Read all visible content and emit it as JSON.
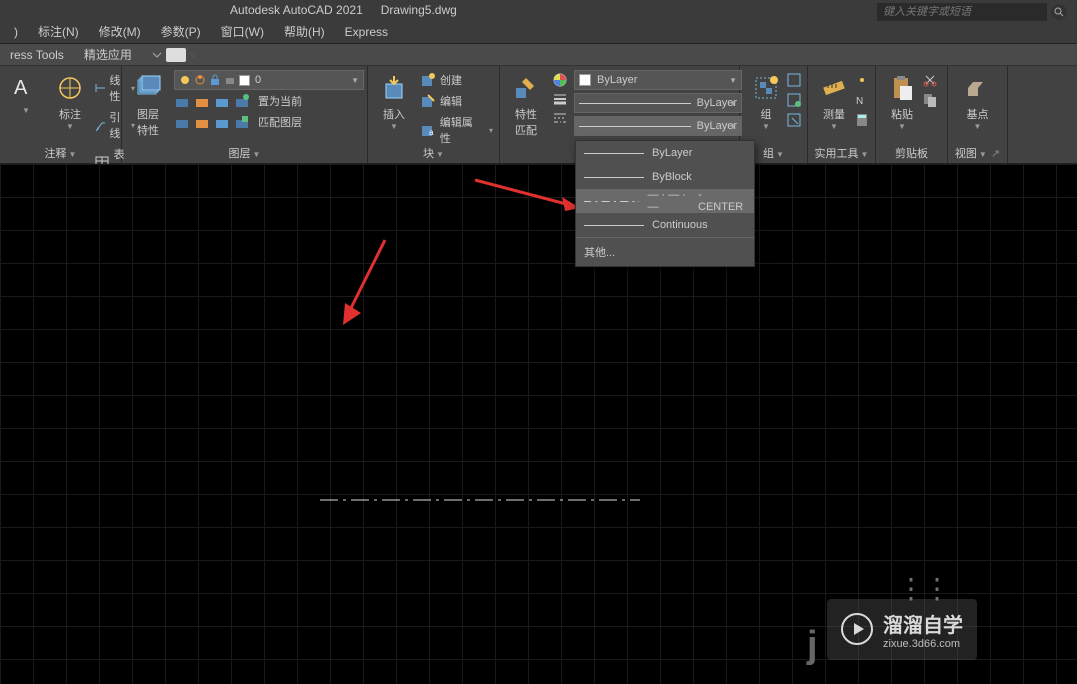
{
  "titlebar": {
    "app": "Autodesk AutoCAD 2021",
    "doc": "Drawing5.dwg"
  },
  "search": {
    "placeholder": "键入关键字或短语"
  },
  "menubar": [
    {
      "label": ")"
    },
    {
      "label": "标注(N)"
    },
    {
      "label": "修改(M)"
    },
    {
      "label": "参数(P)"
    },
    {
      "label": "窗口(W)"
    },
    {
      "label": "帮助(H)"
    },
    {
      "label": "Express"
    }
  ],
  "tabs": {
    "left": "ress Tools",
    "featured": "精选应用"
  },
  "ribbon": {
    "annotate": {
      "dim_label": "标注",
      "linear": "线性",
      "leader": "引线",
      "table": "表格",
      "panel_label": "注释"
    },
    "layers": {
      "big_label": "图层\n特性",
      "current_layer": "0",
      "set_current": "置为当前",
      "match_layer": "匹配图层",
      "panel_label": "图层"
    },
    "block": {
      "insert": "插入",
      "create": "创建",
      "edit": "编辑",
      "edit_attr": "编辑属性",
      "panel_label": "块"
    },
    "props": {
      "match_label": "特性\n匹配",
      "color": "ByLayer",
      "lineweight": "ByLayer",
      "linetype": "ByLayer"
    },
    "group": {
      "label": "组",
      "panel_label": "组"
    },
    "measure": {
      "label": "测量",
      "panel_label": "实用工具"
    },
    "clipboard": {
      "label": "粘贴",
      "panel_label": "剪贴板"
    },
    "view": {
      "label": "基点",
      "panel_label": "视图"
    }
  },
  "linetype_dropdown": {
    "items": [
      {
        "name": "ByLayer"
      },
      {
        "name": "ByBlock"
      },
      {
        "name": "- CENTER"
      },
      {
        "name": "Continuous"
      }
    ],
    "other": "其他..."
  },
  "watermark": {
    "brand": "溜溜自学",
    "url": "zixue.3d66.com"
  }
}
